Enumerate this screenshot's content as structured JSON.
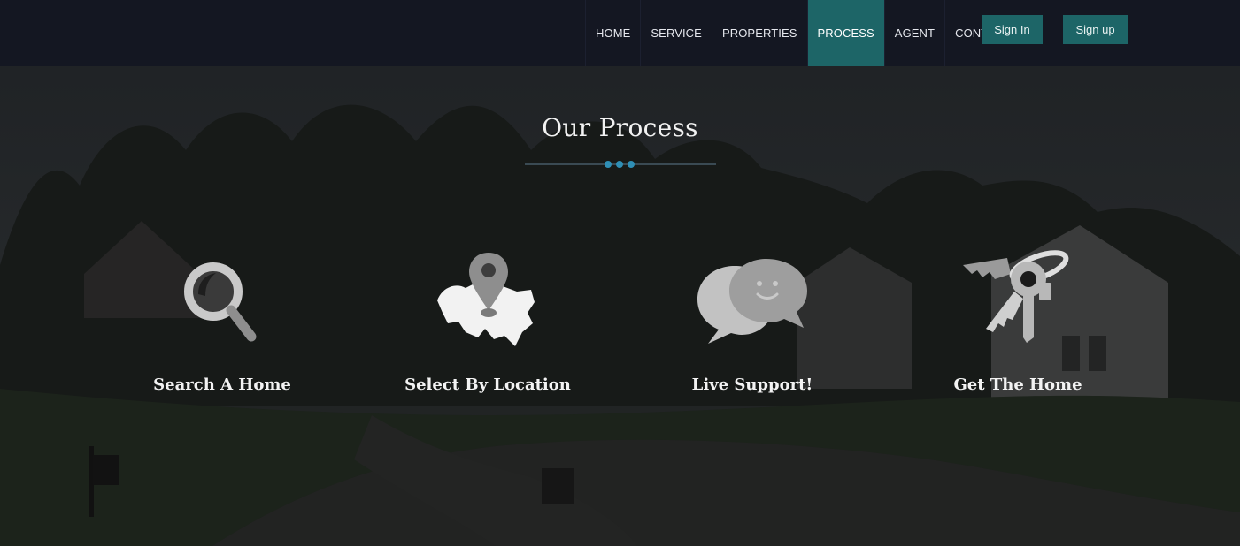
{
  "nav": {
    "items": [
      {
        "label": "HOME",
        "active": false
      },
      {
        "label": "SERVICE",
        "active": false
      },
      {
        "label": "PROPERTIES",
        "active": false
      },
      {
        "label": "PROCESS",
        "active": true
      },
      {
        "label": "AGENT",
        "active": false
      },
      {
        "label": "CONTACT",
        "active": false
      }
    ],
    "signin_label": "Sign In",
    "signup_label": "Sign up"
  },
  "section": {
    "title": "Our Process",
    "divider_dot_color": "#2f8fb5",
    "steps": [
      {
        "label": "Search A Home",
        "icon": "magnifier-icon"
      },
      {
        "label": "Select By Location",
        "icon": "map-pin-icon"
      },
      {
        "label": "Live Support!",
        "icon": "chat-bubbles-icon"
      },
      {
        "label": "Get The Home",
        "icon": "keys-icon"
      }
    ]
  },
  "colors": {
    "accent": "#1d6567",
    "navbar": "#141722",
    "icon_gray": "#c4c4c4"
  }
}
